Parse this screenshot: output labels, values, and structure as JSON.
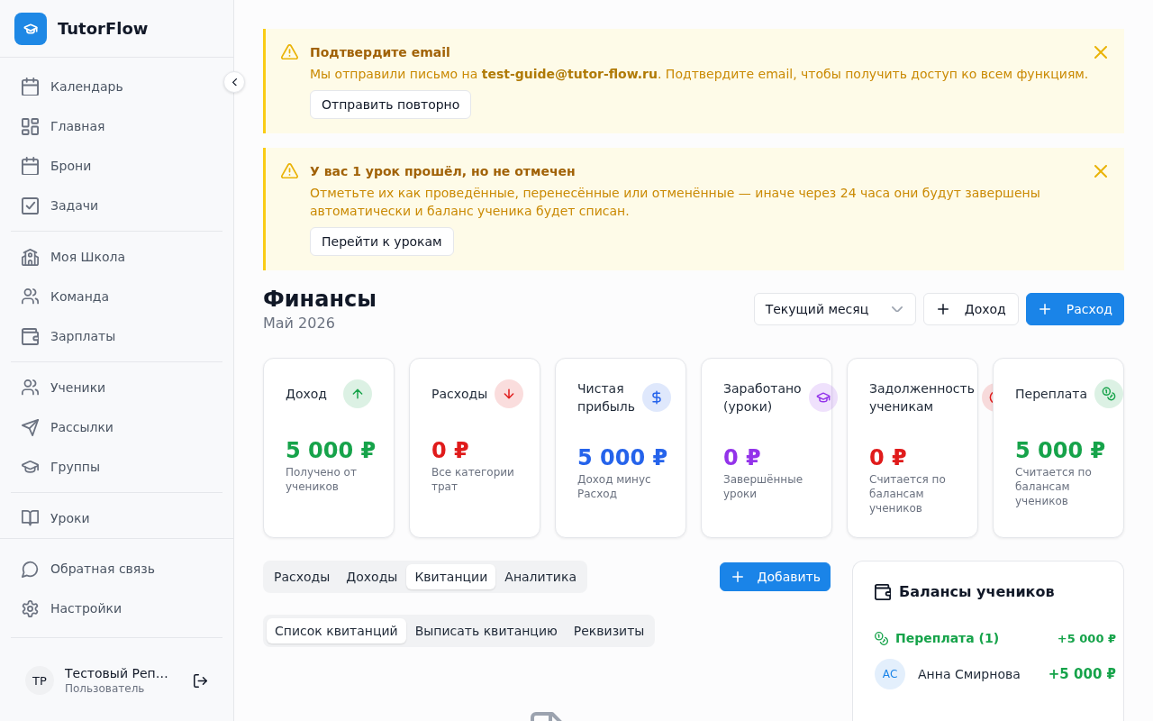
{
  "sidebar": {
    "brand": "TutorFlow",
    "nav_groups": [
      [
        "Календарь",
        "Главная",
        "Брони",
        "Задачи"
      ],
      [
        "Моя Школа",
        "Команда",
        "Зарплаты"
      ],
      [
        "Ученики",
        "Рассылки",
        "Группы"
      ],
      [
        "Уроки"
      ]
    ],
    "footer_items": [
      "Обратная связь",
      "Настройки"
    ],
    "user": {
      "initials": "ТР",
      "name": "Тестовый Реп…",
      "role": "Пользователь"
    }
  },
  "alerts": [
    {
      "title": "Подтвердите email",
      "text": "Мы отправили письмо на **test-guide@tutor-flow.ru**. Подтвердите email, чтобы получить доступ ко всем функциям.",
      "button": "Отправить повторно"
    },
    {
      "title": "У вас 1 урок прошёл, но не отмечен",
      "text": "Отметьте их как проведённые, перенесённые или отменённые — иначе через 24 часа они будут завершены автоматически и баланс ученика будет списан.",
      "button": "Перейти к урокам"
    }
  ],
  "header": {
    "title": "Финансы",
    "subtitle": "Май 2026",
    "period_select": "Текущий месяц",
    "buttons": [
      {
        "label": "Доход",
        "kind": "secondary"
      },
      {
        "label": "Расход",
        "kind": "primary"
      }
    ]
  },
  "stats": [
    {
      "label": "Доход",
      "value": "5 000 ₽",
      "note": "Получено от учеников",
      "color": "#16a34a"
    },
    {
      "label": "Расходы",
      "value": "0 ₽",
      "note": "Все категории трат",
      "color": "#e01b1b"
    },
    {
      "label": "Чистая прибыль",
      "value": "5 000 ₽",
      "note": "Доход минус Расход",
      "color": "#2563eb"
    },
    {
      "label": "Заработано (уроки)",
      "value": "0 ₽",
      "note": "Завершённые уроки",
      "color": "#9333ea"
    },
    {
      "label": "Задолженность ученикам",
      "value": "0 ₽",
      "note": "Считается по балансам учеников",
      "color": "#e01b1b"
    },
    {
      "label": "Переплата",
      "value": "5 000 ₽",
      "note": "Считается по балансам учеников",
      "color": "#16a34a"
    }
  ],
  "tabs": [
    {
      "label": "Расходы",
      "selected": false
    },
    {
      "label": "Доходы",
      "selected": false
    },
    {
      "label": "Квитанции",
      "selected": true
    },
    {
      "label": "Аналитика",
      "selected": false
    }
  ],
  "add_button": "Добавить",
  "subtabs": [
    {
      "label": "Список квитанций",
      "selected": true
    },
    {
      "label": "Выписать квитанцию",
      "selected": false
    },
    {
      "label": "Реквизиты",
      "selected": false
    }
  ],
  "balances": {
    "title": "Балансы учеников",
    "groups": [
      {
        "label": "Переплата (1)",
        "total": "+5 000 ₽",
        "color": "#16a34a",
        "students": [
          {
            "initials": "АС",
            "name": "Анна Смирнова",
            "amount": "+5 000 ₽"
          }
        ]
      }
    ]
  }
}
